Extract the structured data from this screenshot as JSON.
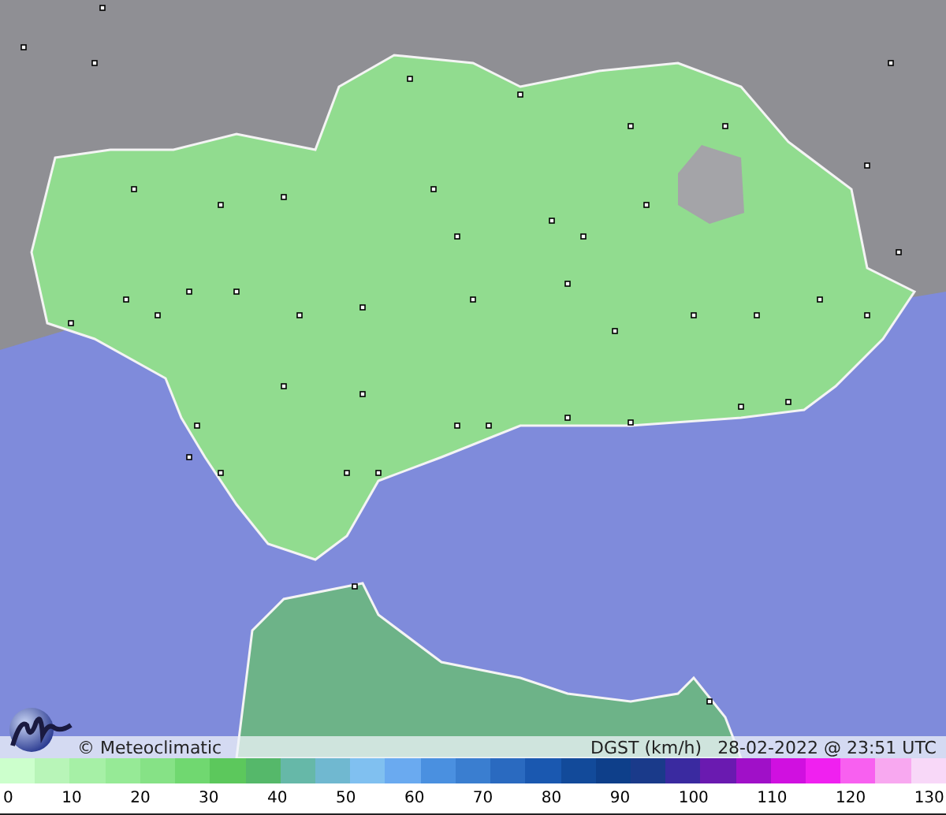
{
  "map": {
    "credit": "© Meteoclimatic",
    "variable": "DGST (km/h)",
    "timestamp": "28-02-2022 @ 23:51 UTC"
  },
  "scale": [
    {
      "color": "#ccffcc"
    },
    {
      "color": "#b8f5b8"
    },
    {
      "color": "#a6f0a6"
    },
    {
      "color": "#96ea96"
    },
    {
      "color": "#86e286"
    },
    {
      "color": "#70d870"
    },
    {
      "color": "#5cc85c"
    },
    {
      "color": "#55b86a"
    },
    {
      "color": "#66b8a8"
    },
    {
      "color": "#70b8d0"
    },
    {
      "color": "#80c0f0"
    },
    {
      "color": "#6aaaf0"
    },
    {
      "color": "#4a90e0"
    },
    {
      "color": "#3a7ed0"
    },
    {
      "color": "#2a6ac0"
    },
    {
      "color": "#1a58b0"
    },
    {
      "color": "#124a9a"
    },
    {
      "color": "#0e3f8a"
    },
    {
      "color": "#1a3a8a"
    },
    {
      "color": "#3a2aa0"
    },
    {
      "color": "#6a1ab0"
    },
    {
      "color": "#a010c8"
    },
    {
      "color": "#d010e0"
    },
    {
      "color": "#f020f0"
    },
    {
      "color": "#f860f0"
    },
    {
      "color": "#f8a8f0"
    },
    {
      "color": "#f8d8f8"
    }
  ],
  "ticks": [
    "0",
    "10",
    "20",
    "30",
    "40",
    "50",
    "60",
    "70",
    "80",
    "90",
    "100",
    "110",
    "120",
    "130"
  ]
}
